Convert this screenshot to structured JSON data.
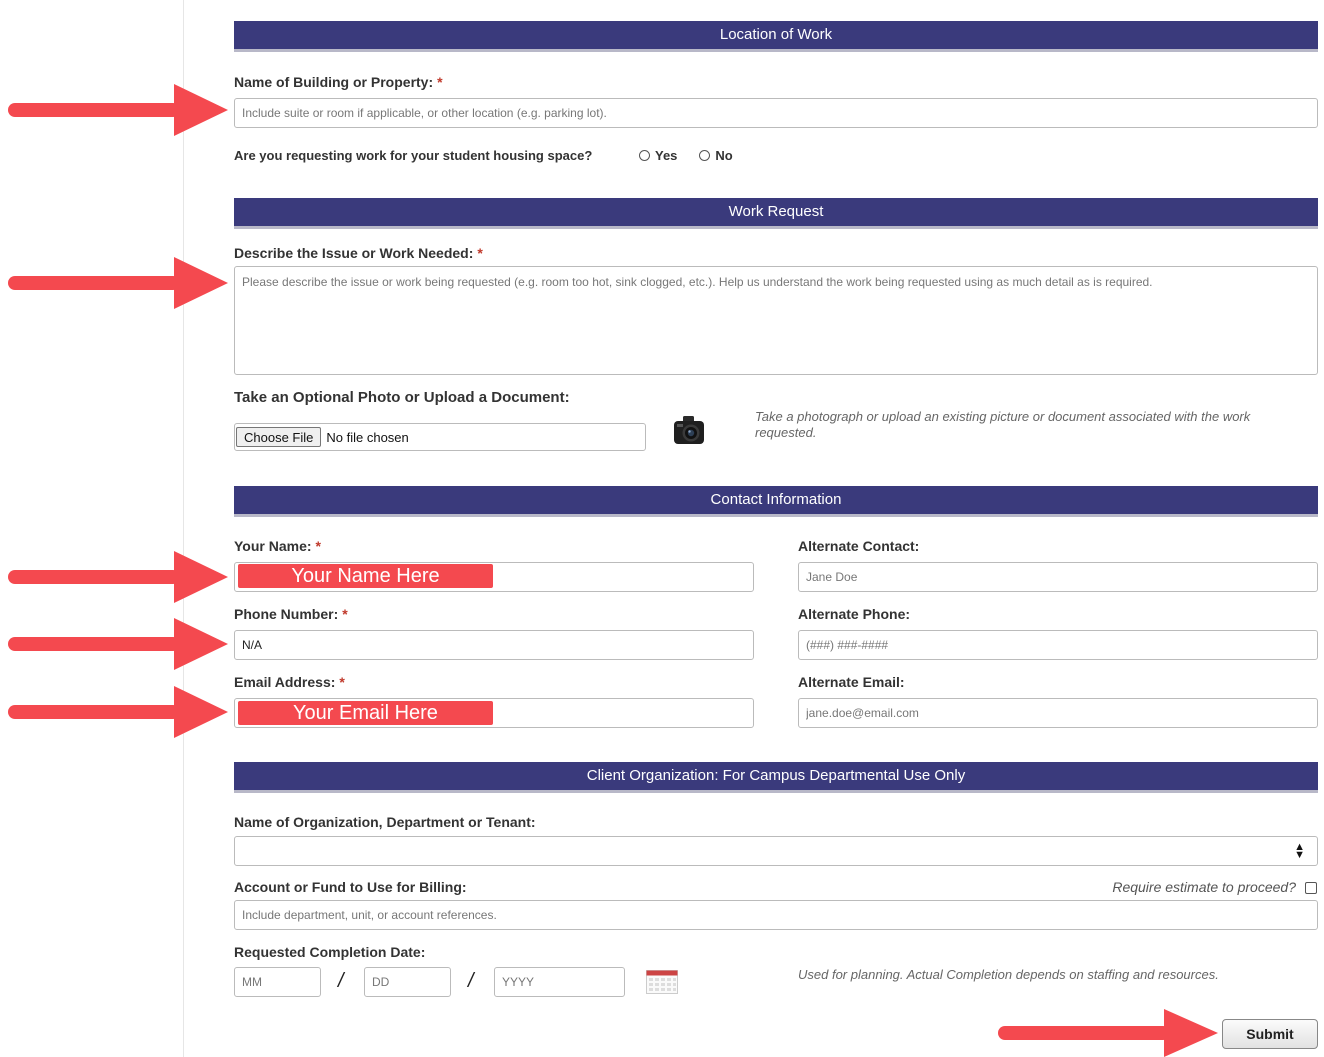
{
  "sections": {
    "location": "Location of Work",
    "work_request": "Work Request",
    "contact": "Contact Information",
    "client_org": "Client Organization: For Campus Departmental Use Only"
  },
  "building": {
    "label": "Name of Building or Property:",
    "required": "*",
    "placeholder": "Include suite or room if applicable, or other location (e.g. parking lot)."
  },
  "housing": {
    "question": "Are you requesting work for your student housing space?",
    "yes": "Yes",
    "no": "No"
  },
  "issue": {
    "label": "Describe the Issue or Work Needed:",
    "required": "*",
    "placeholder": "Please describe the issue or work being requested (e.g. room too hot, sink clogged, etc.). Help us understand the work being requested using as much detail as is required."
  },
  "upload": {
    "label": "Take an Optional Photo or Upload a Document:",
    "button": "Choose File",
    "status": "No file chosen",
    "hint": "Take a photograph or upload an existing picture or document associated with the work requested."
  },
  "contact": {
    "name_label": "Your Name:",
    "name_highlight": "Your Name Here",
    "phone_label": "Phone Number:",
    "phone_value": "N/A",
    "email_label": "Email Address:",
    "email_highlight": "Your Email Here",
    "required": "*",
    "alt_contact_label": "Alternate Contact:",
    "alt_contact_placeholder": "Jane Doe",
    "alt_phone_label": "Alternate Phone:",
    "alt_phone_placeholder": "(###) ###-####",
    "alt_email_label": "Alternate Email:",
    "alt_email_placeholder": "jane.doe@email.com"
  },
  "org": {
    "label": "Name of Organization, Department or Tenant:",
    "selected": ""
  },
  "billing": {
    "label": "Account or Fund to Use for Billing:",
    "estimate": "Require estimate to proceed?",
    "placeholder": "Include department, unit, or account references."
  },
  "completion": {
    "label": "Requested Completion Date:",
    "mm": "MM",
    "dd": "DD",
    "yyyy": "YYYY",
    "separator": "/",
    "hint": "Used for planning. Actual Completion depends on staffing and resources."
  },
  "submit": "Submit",
  "colors": {
    "header_bg": "#3a3a7c",
    "arrow": "#f4494f",
    "required": "#c0392b"
  }
}
